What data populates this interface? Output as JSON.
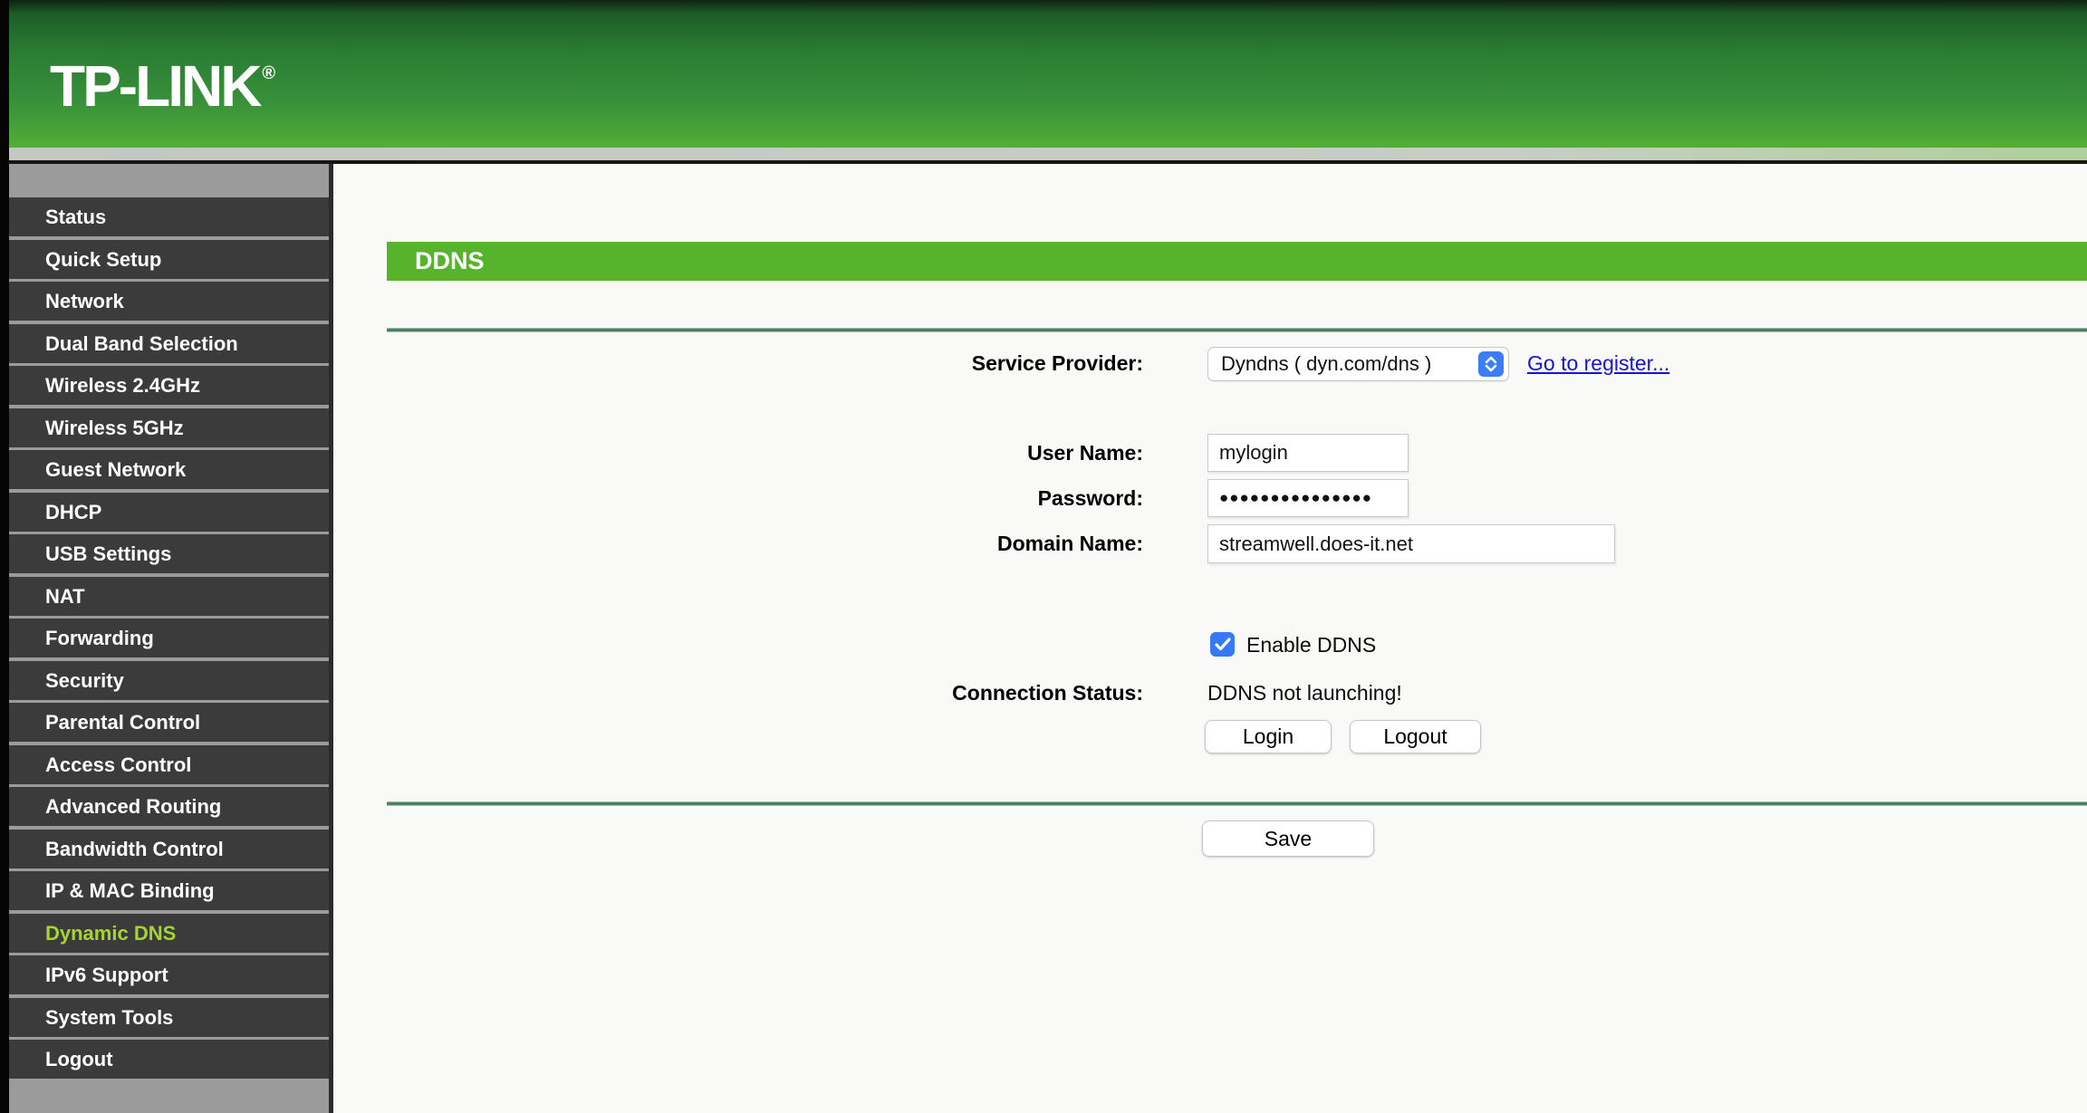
{
  "header": {
    "logo_text": "TP-LINK",
    "registered_mark": "®"
  },
  "sidebar": {
    "items": [
      {
        "id": "status",
        "label": "Status",
        "active": false
      },
      {
        "id": "quick-setup",
        "label": "Quick Setup",
        "active": false
      },
      {
        "id": "network",
        "label": "Network",
        "active": false
      },
      {
        "id": "dual-band-selection",
        "label": "Dual Band Selection",
        "active": false
      },
      {
        "id": "wireless-24ghz",
        "label": "Wireless 2.4GHz",
        "active": false
      },
      {
        "id": "wireless-5ghz",
        "label": "Wireless 5GHz",
        "active": false
      },
      {
        "id": "guest-network",
        "label": "Guest Network",
        "active": false
      },
      {
        "id": "dhcp",
        "label": "DHCP",
        "active": false
      },
      {
        "id": "usb-settings",
        "label": "USB Settings",
        "active": false
      },
      {
        "id": "nat",
        "label": "NAT",
        "active": false
      },
      {
        "id": "forwarding",
        "label": "Forwarding",
        "active": false
      },
      {
        "id": "security",
        "label": "Security",
        "active": false
      },
      {
        "id": "parental-control",
        "label": "Parental Control",
        "active": false
      },
      {
        "id": "access-control",
        "label": "Access Control",
        "active": false
      },
      {
        "id": "advanced-routing",
        "label": "Advanced Routing",
        "active": false
      },
      {
        "id": "bandwidth-control",
        "label": "Bandwidth Control",
        "active": false
      },
      {
        "id": "ip-mac-binding",
        "label": "IP & MAC Binding",
        "active": false
      },
      {
        "id": "dynamic-dns",
        "label": "Dynamic DNS",
        "active": true
      },
      {
        "id": "ipv6-support",
        "label": "IPv6 Support",
        "active": false
      },
      {
        "id": "system-tools",
        "label": "System Tools",
        "active": false
      },
      {
        "id": "logout",
        "label": "Logout",
        "active": false
      }
    ]
  },
  "page": {
    "title": "DDNS",
    "form": {
      "service_provider": {
        "label": "Service Provider:",
        "value": "Dyndns ( dyn.com/dns )",
        "register_link": "Go to register..."
      },
      "user_name": {
        "label": "User Name:",
        "value": "mylogin"
      },
      "password": {
        "label": "Password:",
        "value": "●●●●●●●●●●●●●●●"
      },
      "domain_name": {
        "label": "Domain Name:",
        "value": "streamwell.does-it.net"
      },
      "enable_ddns": {
        "label": "Enable DDNS",
        "checked": true
      },
      "connection_status": {
        "label": "Connection Status:",
        "value": "DDNS not launching!"
      },
      "buttons": {
        "login": "Login",
        "logout": "Logout",
        "save": "Save"
      }
    }
  },
  "colors": {
    "banner_green": "#2b7d33",
    "ddns_bar_green": "#58b32c",
    "active_item_green": "#a4d52f",
    "link_blue": "#1414d6",
    "control_blue": "#3b7df7",
    "sidebar_item_gray": "#3b3b3b"
  }
}
